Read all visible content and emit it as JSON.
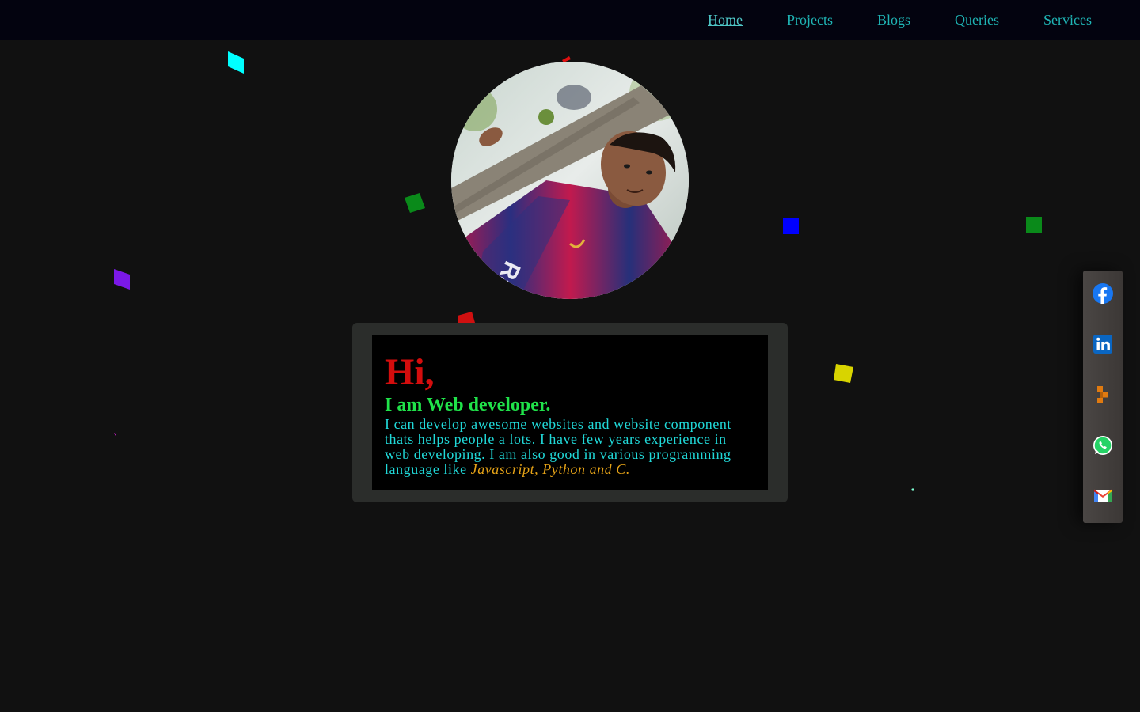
{
  "nav": {
    "items": [
      {
        "label": "Home",
        "active": true
      },
      {
        "label": "Projects",
        "active": false
      },
      {
        "label": "Blogs",
        "active": false
      },
      {
        "label": "Queries",
        "active": false
      },
      {
        "label": "Services",
        "active": false
      }
    ]
  },
  "profile": {
    "photo_icon": "profile-photo"
  },
  "intro": {
    "greeting": "Hi,",
    "role": "I am Web developer.",
    "description": "I can develop awesome websites and website component thats helps people a lots. I have few years experience in web developing. I am also good in various programming language like ",
    "languages": "Javascript, Python and C."
  },
  "social": {
    "items": [
      {
        "name": "facebook-icon",
        "color": "#1877f2"
      },
      {
        "name": "linkedin-icon",
        "color": "#0a66c2"
      },
      {
        "name": "app-logo-icon",
        "color": "#e07a10"
      },
      {
        "name": "whatsapp-icon",
        "color": "#25d366"
      },
      {
        "name": "gmail-icon",
        "color": "#ea4335"
      }
    ]
  },
  "colors": {
    "background": "#111111",
    "navbar": "#03030f",
    "nav_link": "#1fb5b5",
    "greeting": "#d40d0d",
    "role": "#20e34a",
    "description": "#20d8d8",
    "languages": "#e6a317",
    "card_frame": "#2b2d2b"
  }
}
